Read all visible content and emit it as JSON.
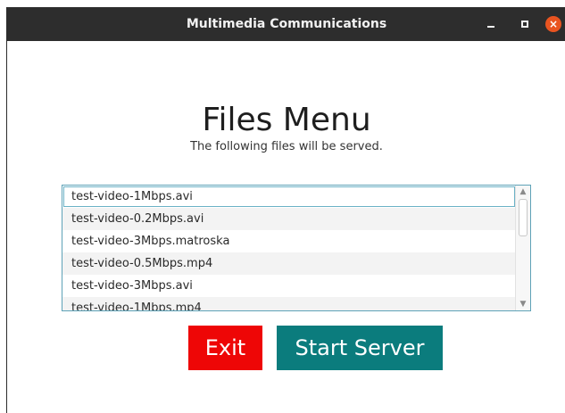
{
  "window": {
    "title": "Multimedia Communications",
    "controls": {
      "minimize_icon": "minimize-icon",
      "maximize_icon": "maximize-icon",
      "close_icon": "close-icon",
      "close_glyph": "×"
    }
  },
  "main": {
    "heading": "Files Menu",
    "subheading": "The following files will be served.",
    "files": [
      "test-video-1Mbps.avi",
      "test-video-0.2Mbps.avi",
      "test-video-3Mbps.matroska",
      "test-video-0.5Mbps.mp4",
      "test-video-3Mbps.avi",
      "test-video-1Mbps.mp4"
    ],
    "selected_index": 0
  },
  "buttons": {
    "exit_label": "Exit",
    "start_label": "Start Server"
  },
  "colors": {
    "titlebar": "#2d2d2d",
    "close": "#e95420",
    "exit": "#ee0606",
    "start": "#0b7c7d",
    "list_border": "#5ea2b7"
  }
}
